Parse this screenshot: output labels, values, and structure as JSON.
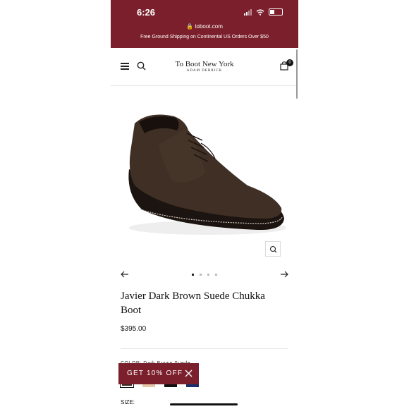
{
  "status_bar": {
    "time": "6:26",
    "battery_level": 0.35
  },
  "browser": {
    "url": "toboot.com"
  },
  "promo_banner": {
    "text": "Free Ground Shipping on Continental US Orders Over $50"
  },
  "header": {
    "brand_name": "To Boot New York",
    "brand_sub": "ADAM DERRICK",
    "cart_count": "0"
  },
  "gallery": {
    "image_count": 4,
    "active_index": 0
  },
  "product": {
    "title": "Javier Dark Brown Suede Chukka Boot",
    "price": "$395.00"
  },
  "options": {
    "color_label": "COLOR: Dark Brown Suede",
    "swatches": [
      {
        "name": "dark-brown",
        "color": "#3b2a20"
      },
      {
        "name": "tan",
        "color": "#e8c7a9"
      },
      {
        "name": "black",
        "color": "#111111"
      },
      {
        "name": "navy",
        "color": "#1c2f6b"
      }
    ],
    "size_label": "SIZE:"
  },
  "discount_popup": {
    "label": "GET 10% OFF"
  },
  "colors": {
    "brand": "#7a1f2b"
  }
}
